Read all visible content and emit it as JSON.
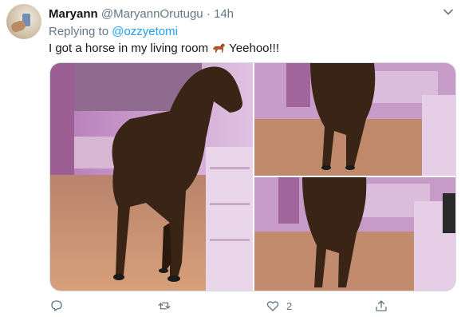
{
  "tweet": {
    "display_name": "Maryann",
    "handle": "@MaryannOrutugu",
    "separator": "·",
    "time": "14h",
    "replying_prefix": "Replying to",
    "replying_to": "@ozzyetomi",
    "text_before": "I got a horse in my living room",
    "emoji": "horse-emoji",
    "text_after": "Yeehoo!!!"
  },
  "actions": {
    "reply_count": "",
    "retweet_count": "",
    "like_count": "2",
    "share_count": ""
  },
  "colors": {
    "link": "#1da1f2",
    "muted": "#657786",
    "text": "#14171a"
  },
  "icons": [
    "avatar",
    "chevron-down-icon",
    "reply-icon",
    "retweet-icon",
    "like-icon",
    "share-icon"
  ]
}
